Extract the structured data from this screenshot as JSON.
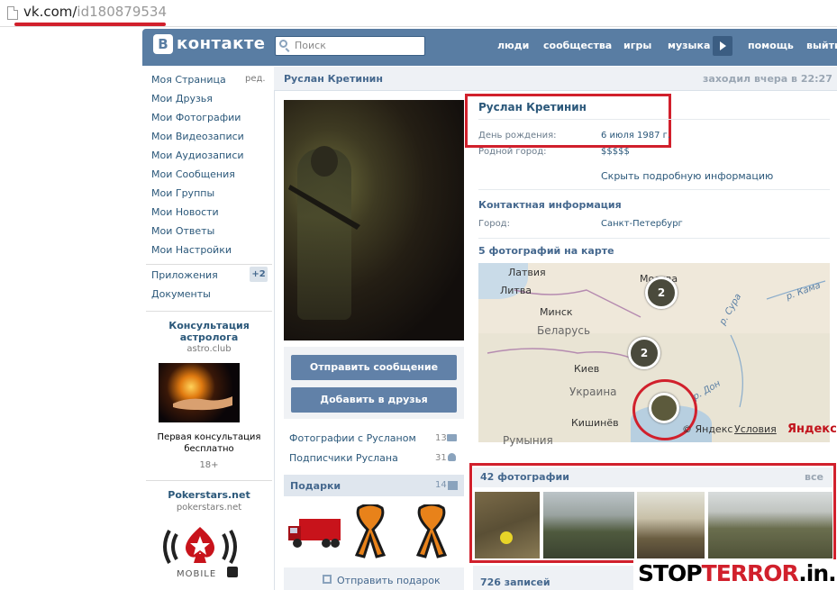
{
  "browser": {
    "url_host": "vk.com/",
    "url_path": "id180879534"
  },
  "header": {
    "logo_letter": "B",
    "logo_text": "контакте",
    "search_placeholder": "Поиск",
    "nav": [
      "люди",
      "сообщества",
      "игры",
      "музыка",
      "помощь",
      "выйти"
    ]
  },
  "menu": {
    "items": [
      "Моя Страница",
      "Мои Друзья",
      "Мои Фотографии",
      "Мои Видеозаписи",
      "Мои Аудиозаписи",
      "Мои Сообщения",
      "Мои Группы",
      "Мои Новости",
      "Мои Ответы",
      "Мои Настройки"
    ],
    "edit": "ред.",
    "apps": "Приложения",
    "apps_badge": "+2",
    "docs": "Документы"
  },
  "ads": [
    {
      "title_line1": "Консультация",
      "title_line2": "астролога",
      "domain": "astro.club",
      "text_line1": "Первая консультация",
      "text_line2": "бесплатно",
      "age": "18+"
    },
    {
      "title": "Pokerstars.net",
      "domain": "pokerstars.net",
      "logo_text": "MOBILE"
    }
  ],
  "profile": {
    "name": "Руслан Кретинин",
    "last_seen": "заходил вчера в 22:27",
    "send_message": "Отправить сообщение",
    "add_friend": "Добавить в друзья",
    "links": [
      {
        "label": "Фотографии с Русланом",
        "count": "13"
      },
      {
        "label": "Подписчики Руслана",
        "count": "31"
      }
    ],
    "gifts_title": "Подарки",
    "gifts_count": "14",
    "send_gift": "Отправить подарок"
  },
  "info": {
    "name": "Руслан Кретинин",
    "birthday_label": "День рождения:",
    "birthday_value": "6 июля 1987 г.",
    "hometown_label": "Родной город:",
    "hometown_value": "$$$$$",
    "hide_info": "Скрыть подробную информацию",
    "contact_title": "Контактная информация",
    "city_label": "Город:",
    "city_value": "Санкт-Петербург",
    "map_title": "5 фотографий на карте"
  },
  "map": {
    "labels": [
      "Латвия",
      "Литва",
      "Минск",
      "Беларусь",
      "Киев",
      "Украина",
      "Кишинёв",
      "Румыния",
      "Москва",
      "р. Сура",
      "р. Кама",
      "р. Дон"
    ],
    "clusters": [
      "2",
      "2"
    ],
    "copyright": "© Яндекс",
    "terms": "Условия",
    "brand": "Яндекс"
  },
  "photos": {
    "title": "42 фотографии",
    "all": "все"
  },
  "posts": {
    "title": "726 записей"
  },
  "watermark": {
    "black": "STOP",
    "red": "TERROR",
    "suffix": ".in.ua"
  },
  "colors": {
    "header": "#597da3",
    "link": "#2b587a",
    "highlight": "#d1202c",
    "button": "#6181a8"
  }
}
